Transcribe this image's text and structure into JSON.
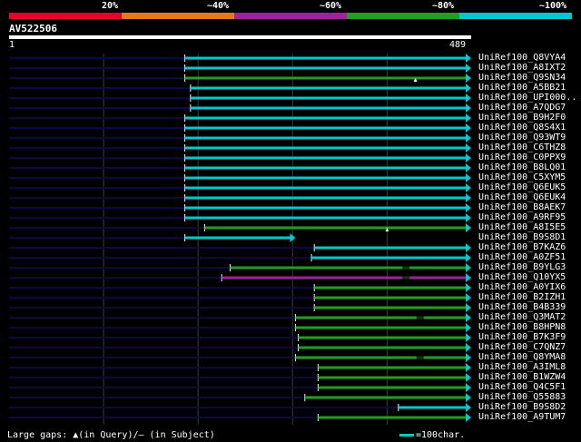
{
  "header": {
    "percent_labels": [
      "20%",
      "~40%",
      "~60%",
      "~80%",
      "~100%"
    ],
    "color_bands": [
      "#e8002a",
      "#e87818",
      "#a020a0",
      "#20a020",
      "#00c8d0"
    ]
  },
  "query": {
    "id": "AV522506",
    "start": "1",
    "end": "489",
    "length": 489
  },
  "legend": {
    "left_text": "Large gaps: ▲(in Query)/– (in Subject)",
    "right_text": "=100char."
  },
  "colors": {
    "cyan": "#00c8d0",
    "green": "#20a020",
    "purple": "#a020a0",
    "query_line": "#0a0a4a",
    "grid": "#3a3a3a"
  },
  "chart_data": {
    "type": "alignment",
    "query_length": 489,
    "hits": [
      {
        "name": "UniRef100_Q8VYA4",
        "start": 186,
        "end": 489,
        "color": "cyan"
      },
      {
        "name": "UniRef100_A8IXT2",
        "start": 186,
        "end": 489,
        "color": "cyan"
      },
      {
        "name": "UniRef100_Q9SN34",
        "start": 186,
        "end": 489,
        "color": "green",
        "gap_query": 430
      },
      {
        "name": "UniRef100_A5BB21",
        "start": 192,
        "end": 489,
        "color": "cyan"
      },
      {
        "name": "UniRef100_UPI000..",
        "start": 192,
        "end": 489,
        "color": "cyan"
      },
      {
        "name": "UniRef100_A7QDG7",
        "start": 192,
        "end": 489,
        "color": "cyan"
      },
      {
        "name": "UniRef100_B9H2F0",
        "start": 186,
        "end": 489,
        "color": "cyan"
      },
      {
        "name": "UniRef100_Q8S4X1",
        "start": 186,
        "end": 489,
        "color": "cyan"
      },
      {
        "name": "UniRef100_Q93WT9",
        "start": 186,
        "end": 489,
        "color": "cyan"
      },
      {
        "name": "UniRef100_C6THZ8",
        "start": 186,
        "end": 489,
        "color": "cyan"
      },
      {
        "name": "UniRef100_C0PPX9",
        "start": 186,
        "end": 489,
        "color": "cyan"
      },
      {
        "name": "UniRef100_B8LQ01",
        "start": 186,
        "end": 489,
        "color": "cyan"
      },
      {
        "name": "UniRef100_C5XYM5",
        "start": 186,
        "end": 489,
        "color": "cyan"
      },
      {
        "name": "UniRef100_Q6EUK5",
        "start": 186,
        "end": 489,
        "color": "cyan"
      },
      {
        "name": "UniRef100_Q6EUK4",
        "start": 186,
        "end": 489,
        "color": "cyan"
      },
      {
        "name": "UniRef100_B8AEK7",
        "start": 186,
        "end": 489,
        "color": "cyan"
      },
      {
        "name": "UniRef100_A9RF95",
        "start": 186,
        "end": 489,
        "color": "cyan"
      },
      {
        "name": "UniRef100_A8I5E5",
        "start": 207,
        "end": 489,
        "color": "green",
        "gap_query": 400
      },
      {
        "name": "UniRef100_B9S8D1",
        "start": 186,
        "end": 303,
        "color": "cyan"
      },
      {
        "name": "UniRef100_B7KAZ6",
        "start": 323,
        "end": 489,
        "color": "cyan"
      },
      {
        "name": "UniRef100_A0ZF51",
        "start": 320,
        "end": 489,
        "color": "cyan"
      },
      {
        "name": "UniRef100_B9YLG3",
        "start": 234,
        "end": 489,
        "color": "green",
        "gap_subject": 420
      },
      {
        "name": "UniRef100_Q10YX5",
        "start": 225,
        "end": 489,
        "color": "purple",
        "gap_subject": 420
      },
      {
        "name": "UniRef100_A0YIX6",
        "start": 323,
        "end": 489,
        "color": "green"
      },
      {
        "name": "UniRef100_B2IZH1",
        "start": 323,
        "end": 489,
        "color": "green"
      },
      {
        "name": "UniRef100_B4B339",
        "start": 323,
        "end": 489,
        "color": "green"
      },
      {
        "name": "UniRef100_Q3MAT2",
        "start": 303,
        "end": 489,
        "color": "green",
        "gap_subject": 435
      },
      {
        "name": "UniRef100_B8HPN8",
        "start": 303,
        "end": 489,
        "color": "green"
      },
      {
        "name": "UniRef100_B7K3F9",
        "start": 306,
        "end": 489,
        "color": "green"
      },
      {
        "name": "UniRef100_C7QNZ7",
        "start": 306,
        "end": 489,
        "color": "green"
      },
      {
        "name": "UniRef100_Q8YMA8",
        "start": 303,
        "end": 489,
        "color": "green",
        "gap_subject": 435
      },
      {
        "name": "UniRef100_A3IML8",
        "start": 327,
        "end": 489,
        "color": "green"
      },
      {
        "name": "UniRef100_B1WZW4",
        "start": 327,
        "end": 489,
        "color": "green"
      },
      {
        "name": "UniRef100_Q4C5F1",
        "start": 327,
        "end": 489,
        "color": "green"
      },
      {
        "name": "UniRef100_Q55883",
        "start": 313,
        "end": 489,
        "color": "green"
      },
      {
        "name": "UniRef100_B9S8D2",
        "start": 412,
        "end": 489,
        "color": "cyan"
      },
      {
        "name": "UniRef100_A9TUM7",
        "start": 327,
        "end": 489,
        "color": "green"
      }
    ]
  }
}
